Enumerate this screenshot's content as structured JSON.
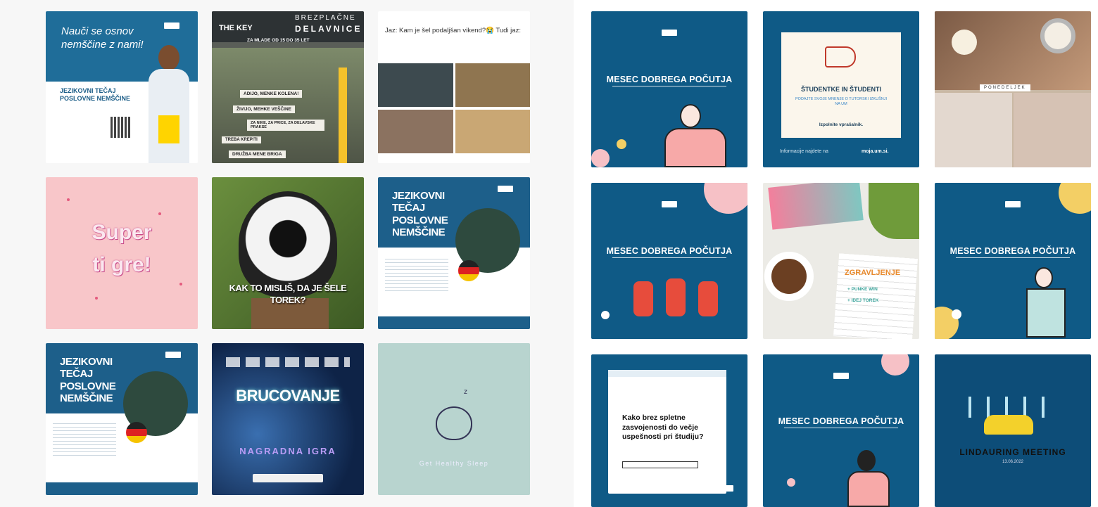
{
  "left_grid": {
    "t1": {
      "title": "Nauči se osnov nemščine z nami!",
      "heading": "JEZIKOVNI TEČAJ POSLOVNE NEMŠČINE"
    },
    "t2": {
      "brand": "THE KEY",
      "header_top": "BREZPLAČNE",
      "header_bottom": "DELAVNICE",
      "subheader": "ZA MLADE OD 15 DO 35 LET",
      "lines": [
        "ADIJO, MENKE KOLENA!",
        "ŽIVIJO, MEHKE VEŠČINE",
        "ZA NIKE, ZA PRICE, ZA DELAVSKE PRAKSE",
        "TREBA KREPITI",
        "DRUŽBA MENE BRIGA"
      ]
    },
    "t3": {
      "caption": "Jaz: Kam je šel podaljšan vikend?😭 Tudi jaz:"
    },
    "t4": {
      "line1": "Super",
      "line2": "ti gre!"
    },
    "t5": {
      "caption": "KAK TO MISLIŠ, DA JE ŠELE TOREK?"
    },
    "t6": {
      "heading": "JEZIKOVNI TEČAJ POSLOVNE NEMŠČINE"
    },
    "t7": {
      "heading": "JEZIKOVNI TEČAJ POSLOVNE NEMŠČINE"
    },
    "t8": {
      "title": "BRUCOVANJE",
      "subtitle": "NAGRADNA IGRA"
    },
    "t9": {
      "caption": "Get Healthy Sleep"
    }
  },
  "right_grid": {
    "r1": {
      "title": "MESEC DOBREGA POČUTJA"
    },
    "r2": {
      "title": "ŠTUDENTKE IN ŠTUDENTI",
      "body": "PODAJTE SVOJE MNENJE O TUTORSKI IZKUŠNJI NA UM",
      "cta": "Izpolnite vprašalnik.",
      "footer_prefix": "Informacije najdete na",
      "footer_link": "moja.um.si."
    },
    "r3": {
      "label": "PONEDELJEK"
    },
    "r4": {
      "title": "MESEC DOBREGA POČUTJA"
    },
    "r5": {
      "title": "ZGRAVLJENJE",
      "items": [
        "+ PUNKE WIN",
        "+ IDEJ TOREK"
      ]
    },
    "r6": {
      "title": "MESEC DOBREGA POČUTJA"
    },
    "r7": {
      "title": "Kako brez spletne zasvojenosti do večje uspešnosti pri študiju?"
    },
    "r8": {
      "title": "MESEC DOBREGA POČUTJA"
    },
    "r9": {
      "title": "LINDAURING MEETING",
      "date": "13.06.2022"
    }
  },
  "colors": {
    "um_blue": "#0f5a86",
    "pink": "#f6c1c6",
    "mint": "#b7d3cf",
    "yellow": "#f5d36a"
  }
}
